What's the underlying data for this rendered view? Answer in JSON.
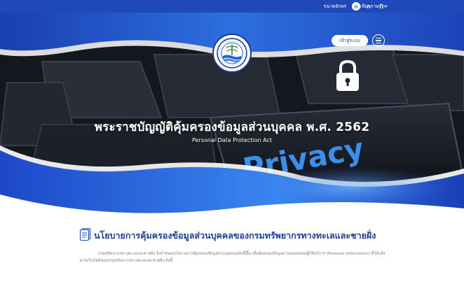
{
  "topbar": {
    "font_size_label": "ขนาดอักษร",
    "font_sizes": [
      "ก",
      "ก",
      "ก"
    ],
    "language_label": "เลือกภาษา"
  },
  "header": {
    "login_label": "เข้าสู่ระบบ"
  },
  "hero": {
    "title": "พระราชบัญญัติคุ้มครองข้อมูลส่วนบุคคล พ.ศ. 2562",
    "subtitle": "Personal Data Protection Act",
    "keyboard_word": "Privacy"
  },
  "section": {
    "title": "นโยบายการคุ้มครองข้อมูลส่วนบุคคลของกรมทรัพยากรทางทะเลและชายฝั่ง",
    "paragraph": "กรมทรัพยากรทางทะเลและชายฝั่ง จึงกำหนดนโยบายการคุ้มครองข้อมูลส่วนบุคคลฉบับนี้ขึ้น เพื่อคุ้มครองข้อมูลส่วนบุคคลของผู้ใช้บริการ (Personal Information) ที่ได้แจ้งผ่านเว็บไซต์ของกรมทรัพยากรทางทะเลและชายฝั่ง ดังนี้"
  },
  "colors": {
    "brand_blue": "#1f49b8",
    "title_blue": "#1f3f95"
  }
}
